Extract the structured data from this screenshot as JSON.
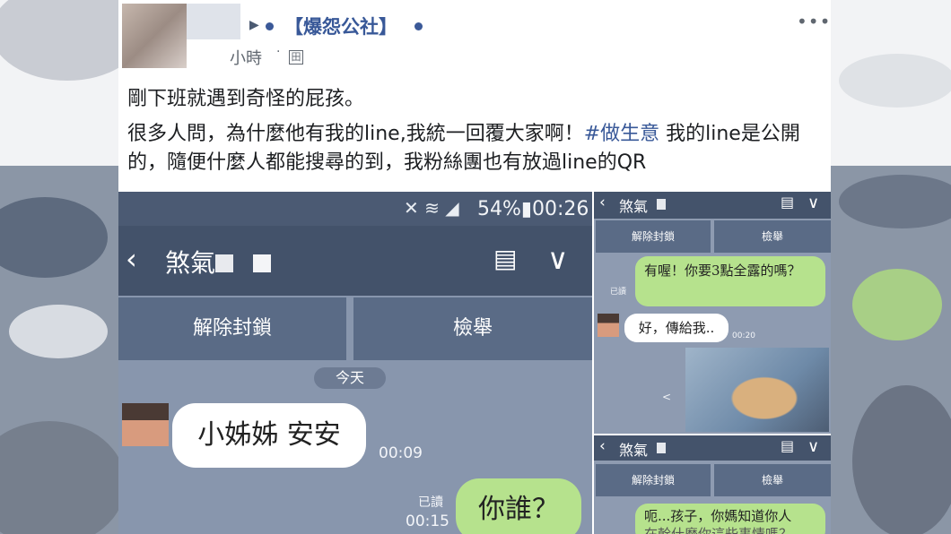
{
  "post": {
    "page_name": "【爆怨公社】",
    "time": "小時",
    "separator": "·",
    "globe": "田",
    "menu": "•••",
    "text1": "剛下班就遇到奇怪的屁孩。",
    "text2_before": "很多人問，為什麼他有我的line,我統一回覆大家啊！",
    "hashtag": "#做生意",
    "text2_after": " 我的line是公開的，隨便什麼人都能搜尋的到，我粉絲團也有放過line的QR"
  },
  "shot1": {
    "status_icons": "✕ ≋ ◢",
    "status_text": "54%▮00:26",
    "back": "‹",
    "contact_name": "煞氣",
    "list_icon": "▤",
    "down_icon": "∨",
    "unblock_label": "解除封鎖",
    "report_label": "檢舉",
    "date_label": "今天",
    "incoming_msg": "小姊姊 安安",
    "incoming_time": "00:09",
    "read_label": "已讀",
    "outgoing_time": "00:15",
    "outgoing_msg": "你誰？"
  },
  "shot2": {
    "back": "‹",
    "contact_name": "煞氣",
    "list_icon": "▤",
    "down_icon": "∨",
    "unblock_label": "解除封鎖",
    "report_label": "檢舉",
    "outgoing_msg": "有喔！你要3點全露的嗎？",
    "read_label": "已讀",
    "incoming_msg": "好，傳給我..",
    "incoming_time": "00:20",
    "share_icon": "<"
  },
  "shot3": {
    "back": "‹",
    "contact_name": "煞氣",
    "list_icon": "▤",
    "down_icon": "∨",
    "unblock_label": "解除封鎖",
    "report_label": "檢舉",
    "outgoing_msg_line1": "呃...孩子，你媽知道你人",
    "outgoing_msg_line2": "在幹什麼你這些事情嗎？"
  }
}
